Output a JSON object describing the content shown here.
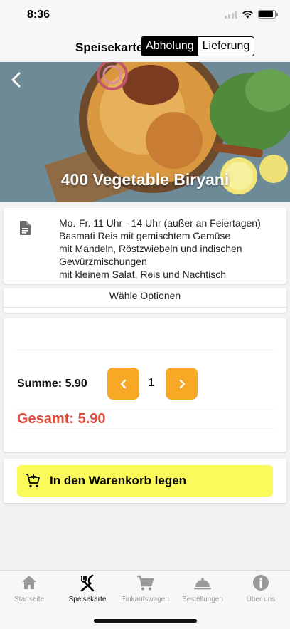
{
  "status_bar": {
    "time": "8:36"
  },
  "header": {
    "title": "Speisekarte",
    "segments": [
      "Abholung",
      "Lieferung"
    ],
    "active_segment": "Abholung"
  },
  "hero": {
    "title": "400 Vegetable Biryani"
  },
  "item_info": {
    "lines": [
      "Mo.-Fr. 11 Uhr - 14 Uhr (außer an Feiertagen)",
      "Basmati Reis mit gemischtem Gemüse\nmit Mandeln, Röstzwiebeln und indischen Gewürzmischungen",
      "mit kleinem Salat, Reis und Nachtisch"
    ]
  },
  "options": {
    "label": "Wähle Optionen"
  },
  "order": {
    "summe_label": "Summe: 5.90",
    "quantity": "1",
    "gesamt_label": "Gesamt: 5.90"
  },
  "cart_button": {
    "label": "In den Warenkorb legen"
  },
  "tabs": [
    {
      "label": "Startseite",
      "icon": "home-icon"
    },
    {
      "label": "Speisekarte",
      "icon": "cutlery-icon"
    },
    {
      "label": "Einkaufswagen",
      "icon": "cart-icon"
    },
    {
      "label": "Bestellungen",
      "icon": "cloche-icon"
    },
    {
      "label": "Über uns",
      "icon": "info-icon"
    }
  ],
  "active_tab": "Speisekarte",
  "colors": {
    "accent": "#f7a824",
    "cart_button": "#fafa5a",
    "total": "#e04b3b"
  }
}
